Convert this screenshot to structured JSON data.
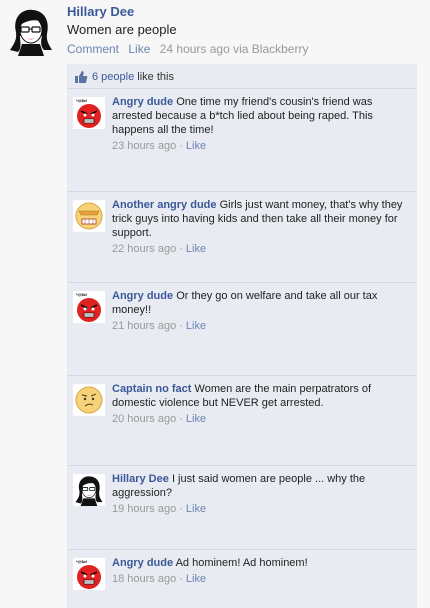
{
  "post": {
    "author": "Hillary Dee",
    "text": "Women are people",
    "actions": {
      "comment": "Comment",
      "like": "Like"
    },
    "timestamp": "24 hours ago via Blackberry",
    "likes": {
      "count_link": "6 people",
      "suffix": "like this"
    }
  },
  "comments": [
    {
      "author": "Angry dude",
      "text": "One time my friend's cousin's friend was arrested because a b*tch lied about being raped. This happens all the time!",
      "time": "23 hours ago",
      "like": "Like",
      "avatar": "angry-face-icon",
      "avatar_caption": "*@$x!"
    },
    {
      "author": "Another angry dude",
      "text": "Girls just want money, that's why they trick guys into having kids and then take all their money for support.",
      "time": "22 hours ago",
      "like": "Like",
      "avatar": "grimace-face-icon"
    },
    {
      "author": "Angry dude",
      "text": "Or they go on welfare and take all our tax money!!",
      "time": "21 hours ago",
      "like": "Like",
      "avatar": "angry-face-icon",
      "avatar_caption": "*@$x!"
    },
    {
      "author": "Captain no fact",
      "text": "Women are the main perpatrators of domestic violence but NEVER get arrested.",
      "time": "20 hours ago",
      "like": "Like",
      "avatar": "confused-face-icon"
    },
    {
      "author": "Hillary Dee",
      "text": "I just said women are people ... why the aggression?",
      "time": "19 hours ago",
      "like": "Like",
      "avatar": "woman-avatar-icon"
    },
    {
      "author": "Angry dude",
      "text": "Ad hominem! Ad hominem!",
      "time": "18 hours ago",
      "like": "Like",
      "avatar": "angry-face-icon",
      "avatar_caption": "*@$x!"
    }
  ],
  "colors": {
    "link": "#3b5998",
    "meta": "#999999",
    "comment_bg": "#e9ebf2",
    "angry_red": "#e12222",
    "face_yellow": "#f6d27a"
  }
}
